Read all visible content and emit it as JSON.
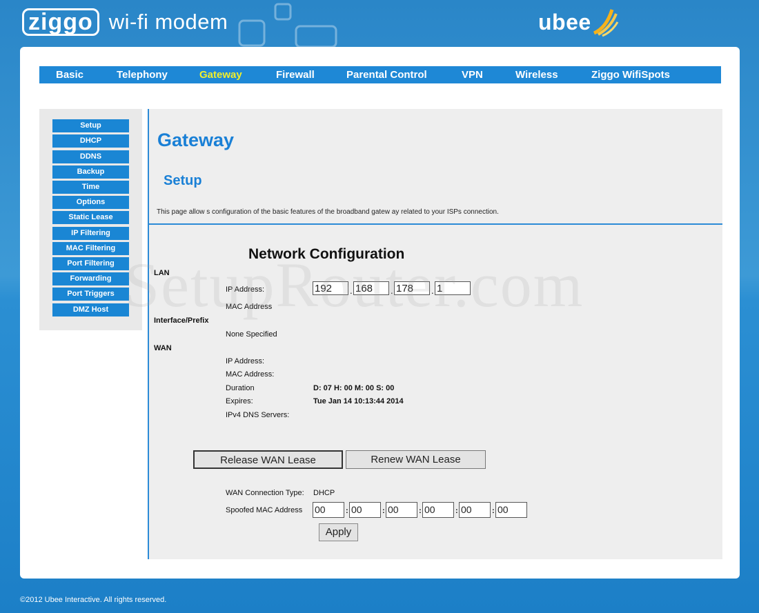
{
  "header": {
    "brand_ziggo": "ziggo",
    "brand_rest": "wi-fi modem",
    "ubee": "ubee"
  },
  "topnav": [
    {
      "label": "Basic"
    },
    {
      "label": "Telephony"
    },
    {
      "label": "Gateway",
      "active": true
    },
    {
      "label": "Firewall"
    },
    {
      "label": "Parental Control"
    },
    {
      "label": "VPN"
    },
    {
      "label": "Wireless"
    },
    {
      "label": "Ziggo WifiSpots"
    }
  ],
  "sidebar": {
    "items": [
      {
        "label": "Setup"
      },
      {
        "label": "DHCP"
      },
      {
        "label": "DDNS"
      },
      {
        "label": "Backup"
      },
      {
        "label": "Time"
      },
      {
        "label": "Options"
      },
      {
        "label": "Static Lease"
      },
      {
        "label": "IP Filtering"
      },
      {
        "label": "MAC Filtering"
      },
      {
        "label": "Port Filtering"
      },
      {
        "label": "Forwarding"
      },
      {
        "label": "Port Triggers"
      },
      {
        "label": "DMZ Host"
      }
    ]
  },
  "main": {
    "title": "Gateway",
    "subtitle": "Setup",
    "description": "This page allow s configuration of the basic features of the broadband gatew ay related to your ISPs connection.",
    "network_config_title": "Network Configuration",
    "lan": {
      "section": "LAN",
      "ip_label": "IP Address:",
      "ip_octets": [
        "192",
        "168",
        "178",
        "1"
      ],
      "mac_label": "MAC Address"
    },
    "interface": {
      "section": "Interface/Prefix",
      "value": "None Specified"
    },
    "wan": {
      "section": "WAN",
      "ip_label": "IP Address:",
      "mac_label": "MAC Address:",
      "duration_label": "Duration",
      "duration_value": "D: 07 H: 00 M: 00 S: 00",
      "expires_label": "Expires:",
      "expires_value": "Tue Jan 14 10:13:44 2014",
      "dns_label": "IPv4 DNS Servers:"
    },
    "buttons": {
      "release": "Release WAN Lease",
      "renew": "Renew WAN Lease",
      "apply": "Apply"
    },
    "wan_conn": {
      "type_label": "WAN Connection Type:",
      "type_value": "DHCP",
      "spoofed_label": "Spoofed MAC Address",
      "spoofed_octets": [
        "00",
        "00",
        "00",
        "00",
        "00",
        "00"
      ]
    }
  },
  "watermark": "SetupRouter.com",
  "footer": "©2012 Ubee Interactive. All rights reserved."
}
